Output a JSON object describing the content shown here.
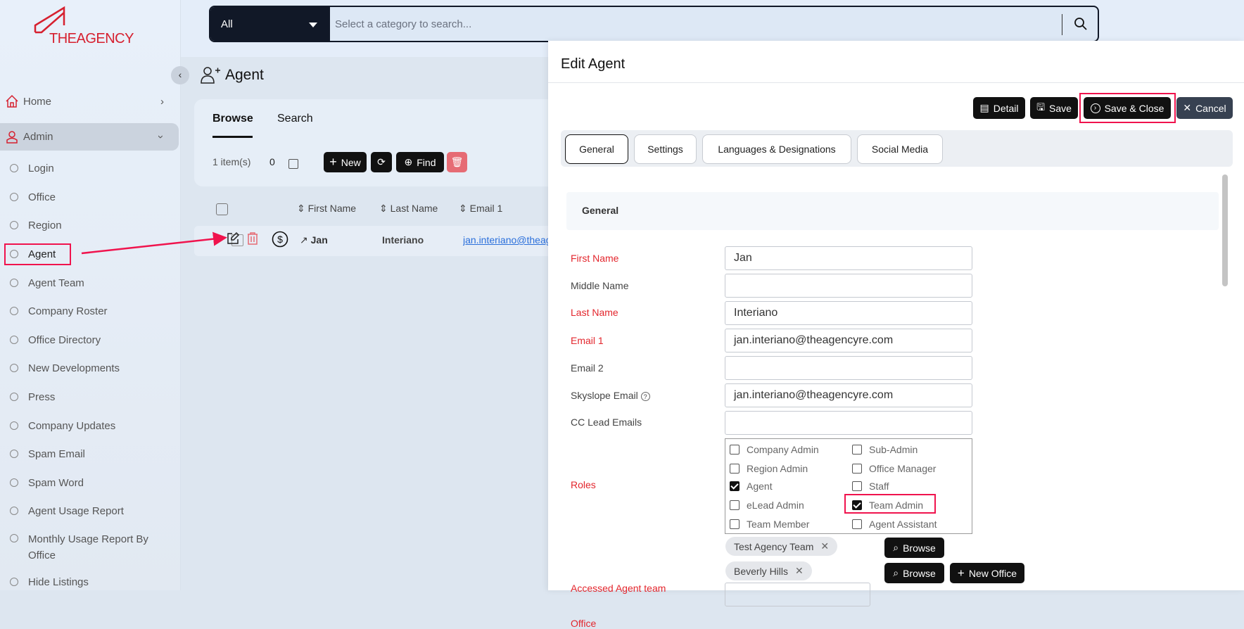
{
  "brand": {
    "name": "THEAGENCY",
    "color": "#d6202f"
  },
  "search": {
    "category": "All",
    "placeholder": "Select a category to search..."
  },
  "sidebar": {
    "items": [
      {
        "label": "Home",
        "icon": "home-icon"
      },
      {
        "label": "Admin",
        "icon": "admin-icon"
      },
      {
        "label": "Login"
      },
      {
        "label": "Office"
      },
      {
        "label": "Region"
      },
      {
        "label": "Agent"
      },
      {
        "label": "Agent Team"
      },
      {
        "label": "Company Roster"
      },
      {
        "label": "Office Directory"
      },
      {
        "label": "New Developments"
      },
      {
        "label": "Press"
      },
      {
        "label": "Company Updates"
      },
      {
        "label": "Spam Email"
      },
      {
        "label": "Spam Word"
      },
      {
        "label": "Agent Usage Report"
      },
      {
        "label": "Monthly Usage Report By Office"
      },
      {
        "label": "Hide Listings"
      }
    ]
  },
  "page": {
    "title": "Agent",
    "tabs": [
      "Browse",
      "Search"
    ],
    "item_count": "1 item(s)",
    "selected_count": "0",
    "toolbar": {
      "new": "New",
      "find": "Find"
    },
    "columns": [
      "First Name",
      "Last Name",
      "Email 1"
    ],
    "rows": [
      {
        "first": "Jan",
        "last": "Interiano",
        "email": "jan.interiano@theagencyre.com"
      }
    ]
  },
  "panel": {
    "title": "Edit Agent",
    "buttons": {
      "detail": "Detail",
      "save": "Save",
      "save_close": "Save & Close",
      "cancel": "Cancel"
    },
    "tabs": [
      "General",
      "Settings",
      "Languages & Designations",
      "Social Media"
    ],
    "section": "General",
    "fields": [
      {
        "label": "First Name",
        "value": "Jan"
      },
      {
        "label": "Middle Name",
        "value": ""
      },
      {
        "label": "Last Name",
        "value": "Interiano"
      },
      {
        "label": "Email 1",
        "value": "jan.interiano@theagencyre.com"
      },
      {
        "label": "Email 2",
        "value": ""
      },
      {
        "label": "Skyslope Email",
        "value": "jan.interiano@theagencyre.com"
      },
      {
        "label": "CC Lead Emails",
        "value": ""
      }
    ],
    "roles_label": "Roles",
    "roles": [
      {
        "label": "Company Admin",
        "checked": false
      },
      {
        "label": "Sub-Admin",
        "checked": false
      },
      {
        "label": "Region Admin",
        "checked": false
      },
      {
        "label": "Office Manager",
        "checked": false
      },
      {
        "label": "Agent",
        "checked": true
      },
      {
        "label": "Staff",
        "checked": false
      },
      {
        "label": "eLead Admin",
        "checked": false
      },
      {
        "label": "Team Admin",
        "checked": true
      },
      {
        "label": "Team Member",
        "checked": false
      },
      {
        "label": "Agent Assistant",
        "checked": false
      }
    ],
    "accessed_team": {
      "label": "Accessed Agent team",
      "chip": "Test Agency Team",
      "browse": "Browse"
    },
    "office": {
      "label": "Office",
      "chip": "Beverly Hills",
      "browse": "Browse",
      "new": "New Office"
    }
  }
}
